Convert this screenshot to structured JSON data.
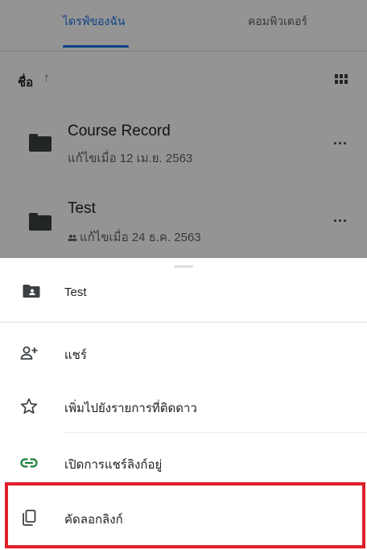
{
  "tabs": {
    "mine": "ไดรฟ์ของฉัน",
    "computers": "คอมพิวเตอร์"
  },
  "sort": {
    "label": "ชื่อ",
    "arrow": "↑",
    "view_icon": "grid-view-icon"
  },
  "files": [
    {
      "name": "Course Record",
      "meta": "แก้ไขเมื่อ 12 เม.ย. 2563",
      "icon": "folder-icon"
    },
    {
      "name": "Test",
      "meta": "แก้ไขเมื่อ 24 ธ.ค. 2563",
      "icon": "shared-folder-icon",
      "meta_icon": "shared-people-icon"
    }
  ],
  "more_glyph": "···",
  "sheet": {
    "title": "Test",
    "actions": [
      {
        "label": "แชร์",
        "icon": "add-person-icon"
      },
      {
        "label": "เพิ่มไปยังรายการที่ติดดาว",
        "icon": "star-outline-icon"
      },
      {
        "label": "เปิดการแชร์ลิงก์อยู่",
        "icon": "link-icon",
        "icon_color": "#188038"
      },
      {
        "label": "คัดลอกลิงก์",
        "icon": "copy-icon"
      }
    ]
  },
  "colors": {
    "accent": "#1a73e8",
    "highlight_border": "#e01e2b",
    "link_green": "#188038"
  }
}
